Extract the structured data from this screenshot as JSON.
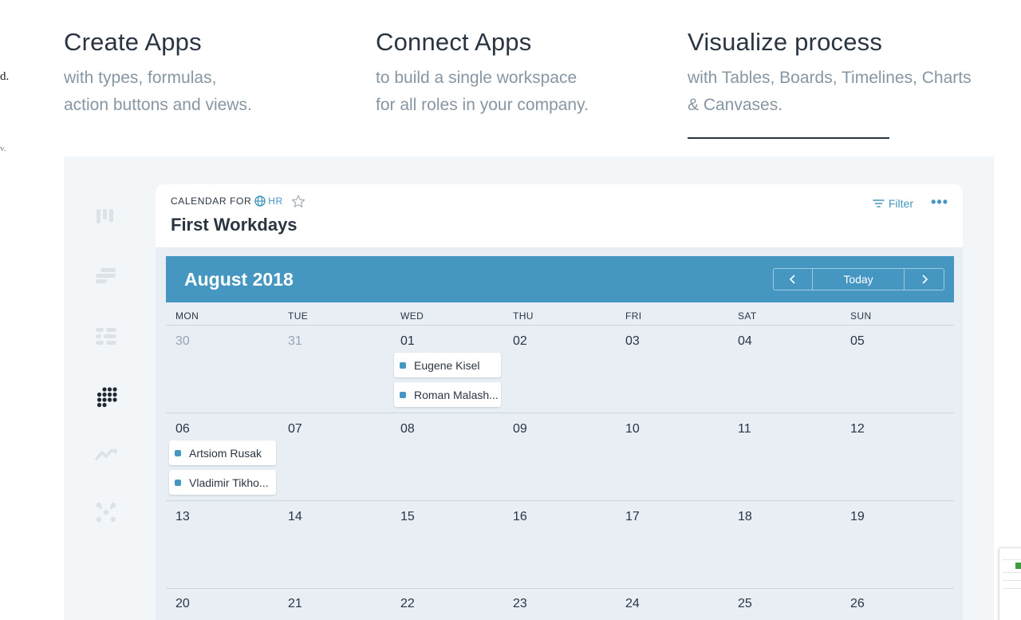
{
  "edge": {
    "char_d": "d.",
    "char_v": "v."
  },
  "features": [
    {
      "title": "Create Apps",
      "line1": "with types, formulas,",
      "line2": "action buttons and views."
    },
    {
      "title": "Connect Apps",
      "line1": "to build a single workspace",
      "line2": "for all roles in your company."
    },
    {
      "title": "Visualize process",
      "line1": "with Tables, Boards, Timelines, Charts",
      "line2": "& Canvases."
    }
  ],
  "sidebar": {
    "icons": [
      "table-view-icon",
      "timeline-view-icon",
      "board-view-icon",
      "calendar-view-icon",
      "chart-view-icon",
      "canvas-view-icon"
    ],
    "active": "calendar-view-icon"
  },
  "calendar": {
    "for_label": "CALENDAR FOR",
    "workspace": "HR",
    "title": "First Workdays",
    "filter_label": "Filter",
    "more_label": "•••",
    "month": "August 2018",
    "today_label": "Today",
    "weekdays": [
      "MON",
      "TUE",
      "WED",
      "THU",
      "FRI",
      "SAT",
      "SUN"
    ],
    "weeks": [
      [
        "30",
        "31",
        "01",
        "02",
        "03",
        "04",
        "05"
      ],
      [
        "06",
        "07",
        "08",
        "09",
        "10",
        "11",
        "12"
      ],
      [
        "13",
        "14",
        "15",
        "16",
        "17",
        "18",
        "19"
      ],
      [
        "20",
        "21",
        "22",
        "23",
        "24",
        "25",
        "26"
      ]
    ],
    "events": [
      {
        "name": "Eugene Kisel",
        "day": "01"
      },
      {
        "name": "Roman Malash...",
        "day": "01"
      },
      {
        "name": "Artsiom Rusak",
        "day": "06"
      },
      {
        "name": "Vladimir Tikho...",
        "day": "06"
      }
    ]
  },
  "colors": {
    "accent": "#4597c1",
    "text": "#2b3542",
    "muted": "#8796a3",
    "panel": "#e8eef4"
  }
}
